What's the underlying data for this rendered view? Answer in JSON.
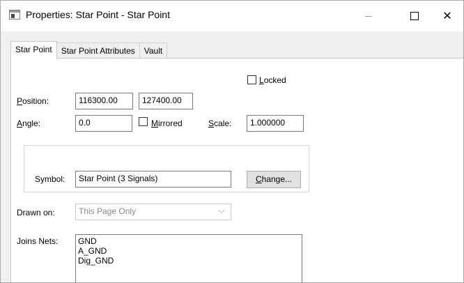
{
  "window": {
    "title": "Properties: Star Point - Star Point",
    "close_glyph": "✕"
  },
  "tabs": [
    {
      "label": "Star Point",
      "active": true
    },
    {
      "label": "Star Point Attributes",
      "active": false
    },
    {
      "label": "Vault",
      "active": false
    }
  ],
  "locked": {
    "label_u": "L",
    "label_rest": "ocked",
    "checked": false
  },
  "position": {
    "label_u": "P",
    "label_rest": "osition:",
    "x": "116300.00",
    "y": "127400.00"
  },
  "angle": {
    "label_u": "A",
    "label_rest": "ngle:",
    "value": "0.0"
  },
  "mirrored": {
    "label_u": "M",
    "label_rest": "irrored",
    "checked": false
  },
  "scale": {
    "label_u": "S",
    "label_rest": "cale:",
    "value": "1.000000"
  },
  "symbol": {
    "label": "Symbol:",
    "value": "Star Point (3 Signals)",
    "button_u": "C",
    "button_rest": "hange..."
  },
  "drawn_on": {
    "label": "Drawn on:",
    "value": "This Page Only",
    "arrow_glyph": "﹀"
  },
  "joins_nets": {
    "label": "Joins Nets:",
    "items": [
      "GND",
      "A_GND",
      "Dig_GND"
    ]
  }
}
